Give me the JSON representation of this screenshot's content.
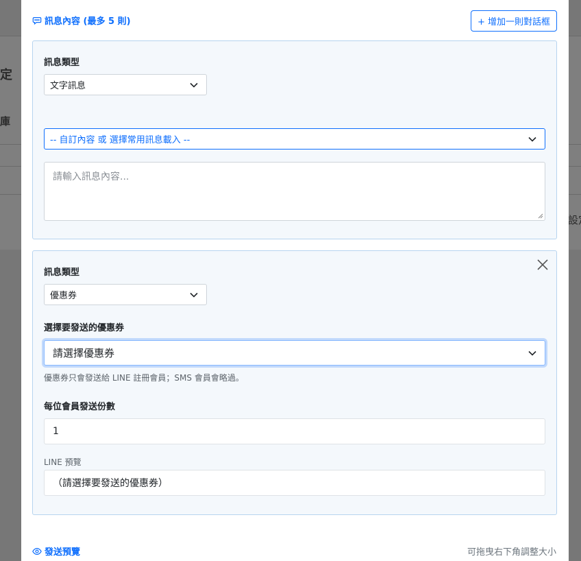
{
  "background": {
    "left_char_1": "定",
    "left_char_2": "庫",
    "right_text": "設定"
  },
  "messages": {
    "title": "訊息內容 (最多 5 則)",
    "add_button": "+ 增加一則對話框"
  },
  "card1": {
    "type_label": "訊息類型",
    "type_value": "文字訊息",
    "template_value": "-- 自訂內容 或 選擇常用訊息載入 --",
    "content_placeholder": "請輸入訊息內容..."
  },
  "card2": {
    "type_label": "訊息類型",
    "type_value": "優惠券",
    "coupon_label": "選擇要發送的優惠券",
    "coupon_value": "請選擇優惠券",
    "coupon_hint": "優惠券只會發送給 LINE 註冊會員；SMS 會員會略過。",
    "qty_label": "每位會員發送份數",
    "qty_value": "1",
    "preview_label": "LINE 預覽",
    "preview_value": "（請選擇要發送的優惠券）"
  },
  "footer": {
    "preview_link": "發送預覽",
    "resize_hint": "可拖曳右下角調整大小"
  },
  "colors": {
    "accent": "#0d6efd",
    "card_bg": "#f4f8fc",
    "card_border": "#b6d4ef"
  }
}
